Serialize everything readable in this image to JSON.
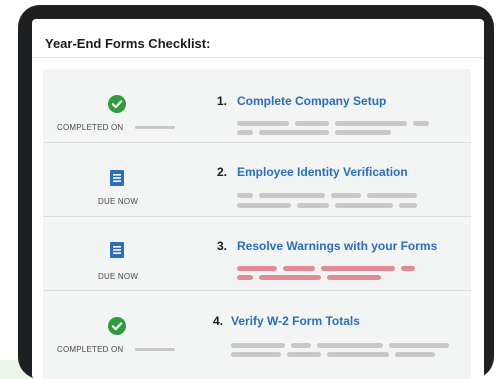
{
  "checklist": {
    "title": "Year-End Forms Checklist:",
    "steps": [
      {
        "number": "1.",
        "title": "Complete Company Setup",
        "status_label": "COMPLETED ON",
        "status": "completed",
        "icon": "check-circle-icon"
      },
      {
        "number": "2.",
        "title": "Employee Identity Verification",
        "status_label": "DUE NOW",
        "status": "due",
        "icon": "document-icon"
      },
      {
        "number": "3.",
        "title": "Resolve Warnings with your Forms",
        "status_label": "DUE NOW",
        "status": "warning",
        "icon": "document-icon"
      },
      {
        "number": "4.",
        "title": "Verify W-2 Form Totals",
        "status_label": "COMPLETED ON",
        "status": "completed",
        "icon": "check-circle-icon"
      }
    ]
  },
  "colors": {
    "check_green": "#2e9b3c",
    "doc_blue": "#2a6ebd",
    "link_blue": "#2a6ebd",
    "placeholder_gray": "#c8c8c8",
    "warning_red": "#e38b95"
  }
}
